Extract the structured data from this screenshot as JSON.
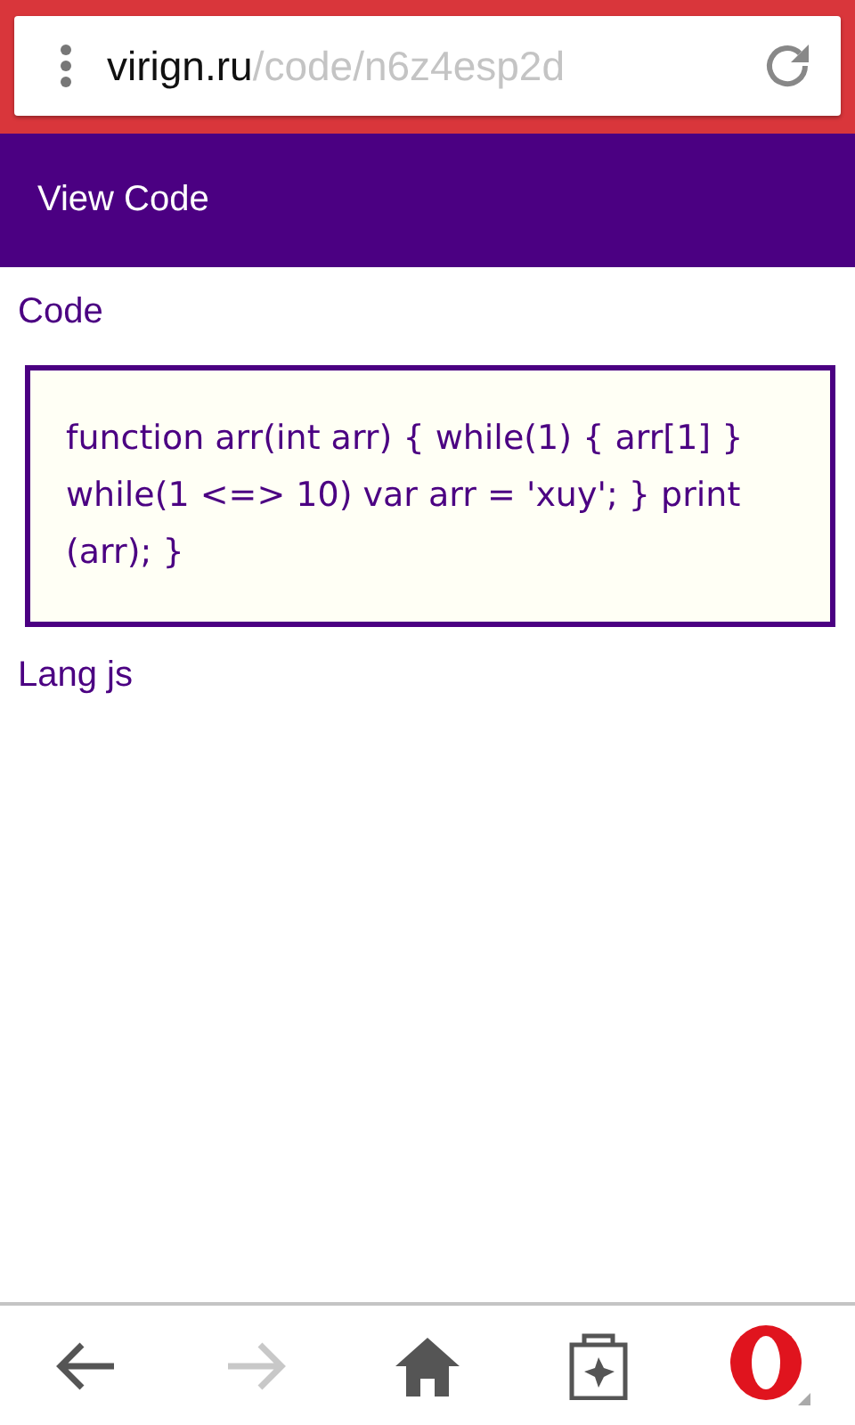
{
  "address_bar": {
    "domain": "virign.ru",
    "path": "/code/n6z4esp2d"
  },
  "header": {
    "title": "View Code"
  },
  "content": {
    "heading": "Code",
    "code": "function arr(int  arr) { while(1) { arr[1]  } while(1  <=> 10) var arr = 'xuy'; } print (arr);  }",
    "lang": "Lang js"
  },
  "nav": [
    {
      "kind": "back",
      "disabled": false
    },
    {
      "kind": "forward",
      "disabled": true
    },
    {
      "kind": "home",
      "disabled": false
    },
    {
      "kind": "tabs",
      "disabled": false
    },
    {
      "kind": "menu",
      "disabled": false
    }
  ]
}
